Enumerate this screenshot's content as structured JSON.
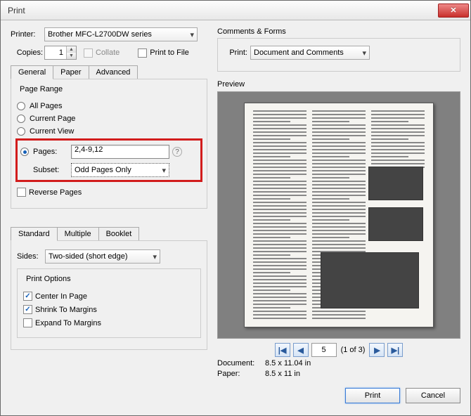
{
  "window_title": "Print",
  "printer_label": "Printer:",
  "printer_selected": "Brother MFC-L2700DW series",
  "copies_label": "Copies:",
  "copies_value": "1",
  "collate_label": "Collate",
  "print_to_file_label": "Print to File",
  "tabs_top": {
    "general": "General",
    "paper": "Paper",
    "advanced": "Advanced"
  },
  "page_range": {
    "title": "Page Range",
    "all": "All Pages",
    "current_page": "Current Page",
    "current_view": "Current View",
    "pages": "Pages:",
    "pages_value": "2,4-9,12",
    "subset_label": "Subset:",
    "subset_value": "Odd Pages Only",
    "reverse": "Reverse Pages"
  },
  "tabs_mid": {
    "standard": "Standard",
    "multiple": "Multiple",
    "booklet": "Booklet"
  },
  "sides_label": "Sides:",
  "sides_value": "Two-sided (short edge)",
  "print_options": {
    "title": "Print Options",
    "center": "Center In Page",
    "shrink": "Shrink To Margins",
    "expand": "Expand To Margins"
  },
  "comments": {
    "title": "Comments & Forms",
    "print_label": "Print:",
    "print_value": "Document and Comments"
  },
  "preview_label": "Preview",
  "page_nav": {
    "current": "5",
    "total_text": "(1 of 3)"
  },
  "doc_info": {
    "document_label": "Document:",
    "document_value": "8.5 x 11.04 in",
    "paper_label": "Paper:",
    "paper_value": "8.5 x 11 in"
  },
  "buttons": {
    "print": "Print",
    "cancel": "Cancel"
  }
}
